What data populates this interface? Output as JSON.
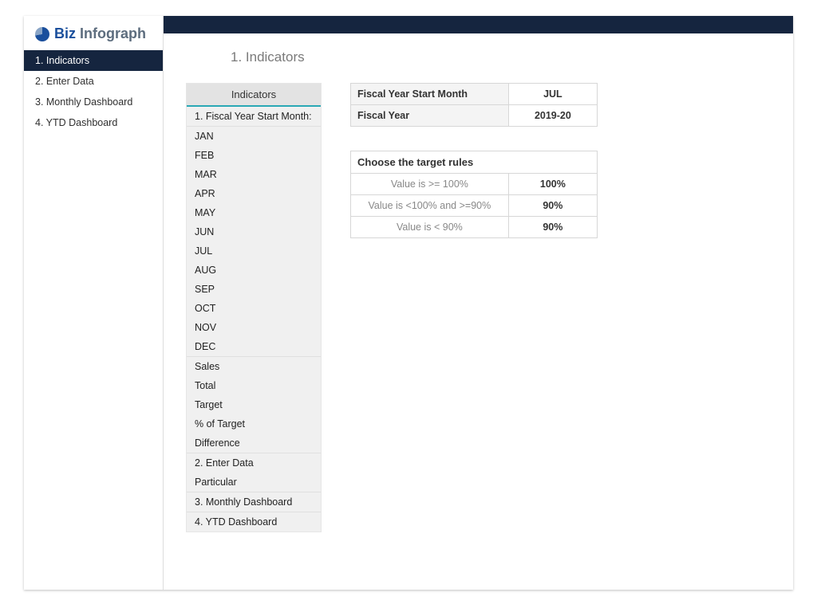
{
  "brand": {
    "part1": "Biz",
    "part2": "Infograph"
  },
  "nav": {
    "items": [
      {
        "label": "1. Indicators",
        "active": true
      },
      {
        "label": "2. Enter Data"
      },
      {
        "label": "3. Monthly Dashboard"
      },
      {
        "label": "4. YTD Dashboard"
      }
    ]
  },
  "page": {
    "title": "1. Indicators"
  },
  "indicators": {
    "header": "Indicators",
    "rows": [
      "1. Fiscal Year Start Month:",
      "JAN",
      "FEB",
      "MAR",
      "APR",
      "MAY",
      "JUN",
      "JUL",
      "AUG",
      "SEP",
      "OCT",
      "NOV",
      "DEC",
      "Sales",
      "Total",
      "Target",
      "% of Target",
      "Difference",
      "2. Enter Data",
      "Particular",
      "3. Monthly Dashboard",
      "4. YTD Dashboard"
    ],
    "dividers_after": [
      0,
      12,
      17,
      19,
      20
    ]
  },
  "fiscal": {
    "rows": [
      {
        "label": "Fiscal Year Start Month",
        "value": "JUL"
      },
      {
        "label": "Fiscal Year",
        "value": "2019-20"
      }
    ]
  },
  "rules": {
    "caption": "Choose the target rules",
    "rows": [
      {
        "label": "Value is >= 100%",
        "value": "100%"
      },
      {
        "label": "Value is <100% and >=90%",
        "value": "90%"
      },
      {
        "label": "Value is < 90%",
        "value": "90%"
      }
    ]
  }
}
